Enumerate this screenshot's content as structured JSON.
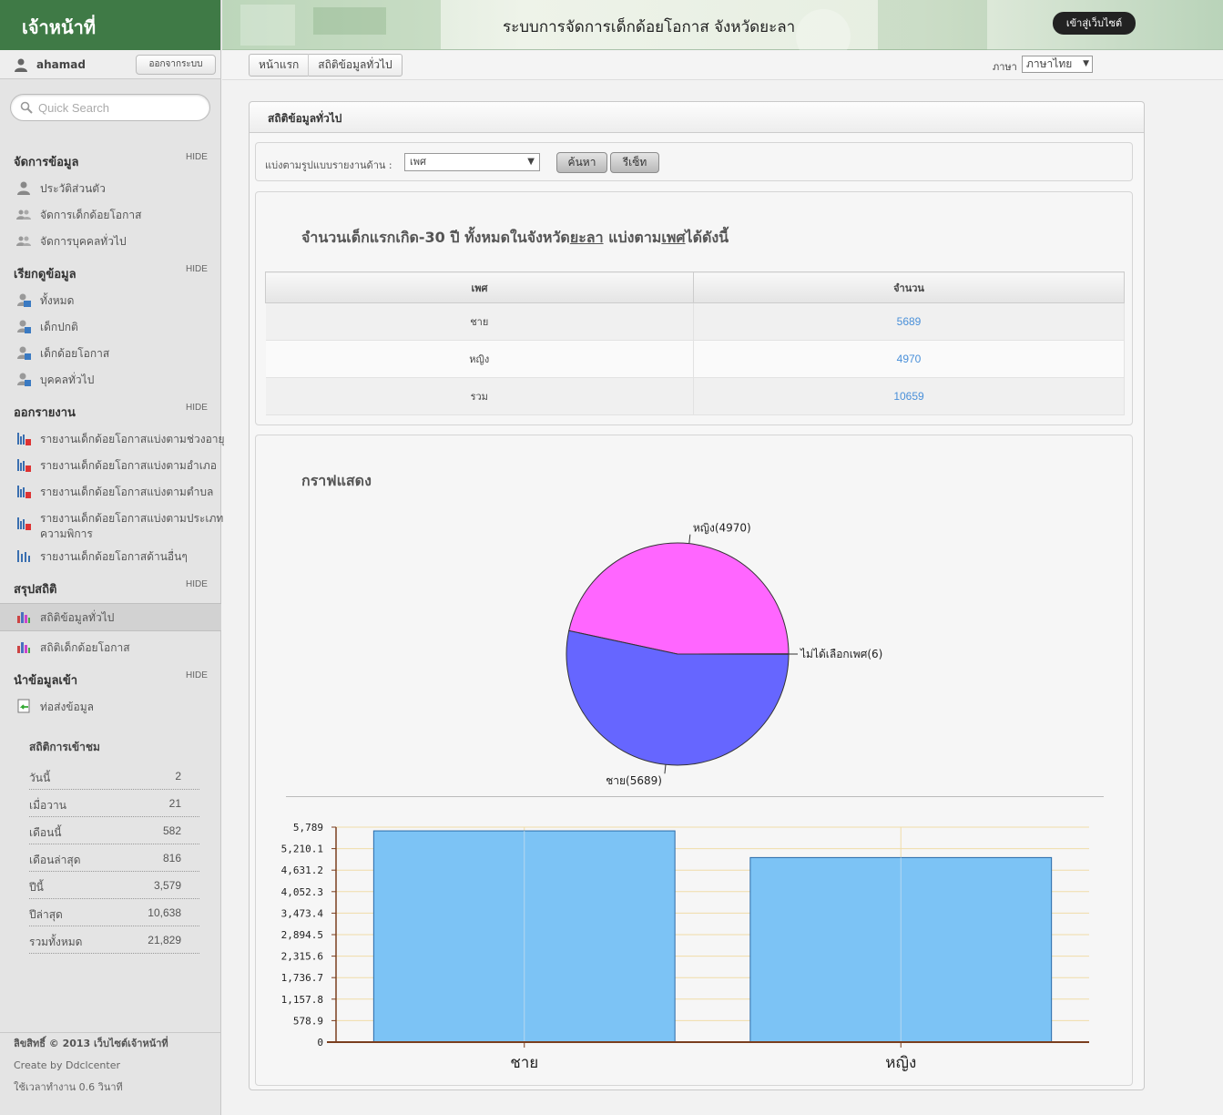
{
  "sidebar": {
    "header": "เจ้าหน้าที่",
    "user": "ahamad",
    "logout": "ออกจากระบบ",
    "search_placeholder": "Quick Search",
    "hide": "HIDE",
    "sections": {
      "manage": {
        "title": "จัดการข้อมูล",
        "items": [
          "ประวัติส่วนตัว",
          "จัดการเด็กด้อยโอกาส",
          "จัดการบุคคลทั่วไป"
        ]
      },
      "view": {
        "title": "เรียกดูข้อมูล",
        "items": [
          "ทั้งหมด",
          "เด็กปกติ",
          "เด็กด้อยโอกาส",
          "บุคคลทั่วไป"
        ]
      },
      "report": {
        "title": "ออกรายงาน",
        "items": [
          "รายงานเด็กด้อยโอกาสแบ่งตามช่วงอายุ",
          "รายงานเด็กด้อยโอกาสแบ่งตามอำเภอ",
          "รายงานเด็กด้อยโอกาสแบ่งตามตำบล",
          "รายงานเด็กด้อยโอกาสแบ่งตามประเภท",
          "ความพิการ",
          "รายงานเด็กด้อยโอกาสด้านอื่นๆ"
        ]
      },
      "summary": {
        "title": "สรุปสถิติ",
        "items": [
          "สถิติข้อมูลทั่วไป",
          "สถิติเด็กด้อยโอกาส"
        ]
      },
      "import": {
        "title": "นำข้อมูลเข้า",
        "items": [
          "ท่อส่งข้อมูล"
        ]
      }
    },
    "visits": {
      "title": "สถิติการเข้าชม",
      "rows": [
        {
          "label": "วันนี้",
          "value": "2"
        },
        {
          "label": "เมื่อวาน",
          "value": "21"
        },
        {
          "label": "เดือนนี้",
          "value": "582"
        },
        {
          "label": "เดือนล่าสุด",
          "value": "816"
        },
        {
          "label": "ปีนี้",
          "value": "3,579"
        },
        {
          "label": "ปีล่าสุด",
          "value": "10,638"
        },
        {
          "label": "รวมทั้งหมด",
          "value": "21,829"
        }
      ]
    },
    "footer": [
      "ลิขสิทธิ์ © 2013 เว็บไซต์เจ้าหน้าที่",
      "Create by Ddclcenter",
      "ใช้เวลาทำงาน 0.6 วินาที"
    ]
  },
  "topbar": {
    "title": "ระบบการจัดการเด็กด้อยโอกาส จังหวัดยะลา",
    "go_site": "เข้าสู่เว็บไซต์"
  },
  "breadcrumb": {
    "home": "หน้าแรก",
    "current": "สถิติข้อมูลทั่วไป",
    "lang_label": "ภาษา",
    "lang_value": "ภาษาไทย"
  },
  "panel": {
    "title": "สถิติข้อมูลทั่วไป",
    "filter_label": "แบ่งตามรูปแบบรายงานด้าน :",
    "filter_value": "เพศ",
    "search_btn": "ค้นหา",
    "reset_btn": "รีเซ็ท",
    "heading_pre": "จำนวนเด็กแรกเกิด-30 ปี ทั้งหมดในจังหวัด",
    "heading_province": "ยะลา",
    "heading_mid": " แบ่งตาม",
    "heading_group": "เพศ",
    "heading_post": "ได้ดังนี้",
    "table": {
      "headers": [
        "เพศ",
        "จำนวน"
      ],
      "rows": [
        [
          "ชาย",
          "5689"
        ],
        [
          "หญิง",
          "4970"
        ],
        [
          "รวม",
          "10659"
        ]
      ]
    },
    "chart_title": "กราฟแสดง"
  },
  "chart_data": [
    {
      "type": "pie",
      "slices": [
        {
          "label": "หญิง(4970)",
          "value": 4970,
          "color": "#ff66ff"
        },
        {
          "label": "ไม่ได้เลือกเพศ(6)",
          "value": 6,
          "color": "#ffffff"
        },
        {
          "label": "ชาย(5689)",
          "value": 5689,
          "color": "#6666ff"
        }
      ]
    },
    {
      "type": "bar",
      "categories": [
        "ชาย",
        "หญิง"
      ],
      "values": [
        5689,
        4970
      ],
      "ylim": [
        0,
        5789
      ],
      "yticks": [
        "0",
        "578.9",
        "1,157.8",
        "1,736.7",
        "2,315.6",
        "2,894.5",
        "3,473.4",
        "4,052.3",
        "4,631.2",
        "5,210.1",
        "5,789"
      ],
      "bar_color": "#7cc3f5",
      "grid": true
    }
  ]
}
